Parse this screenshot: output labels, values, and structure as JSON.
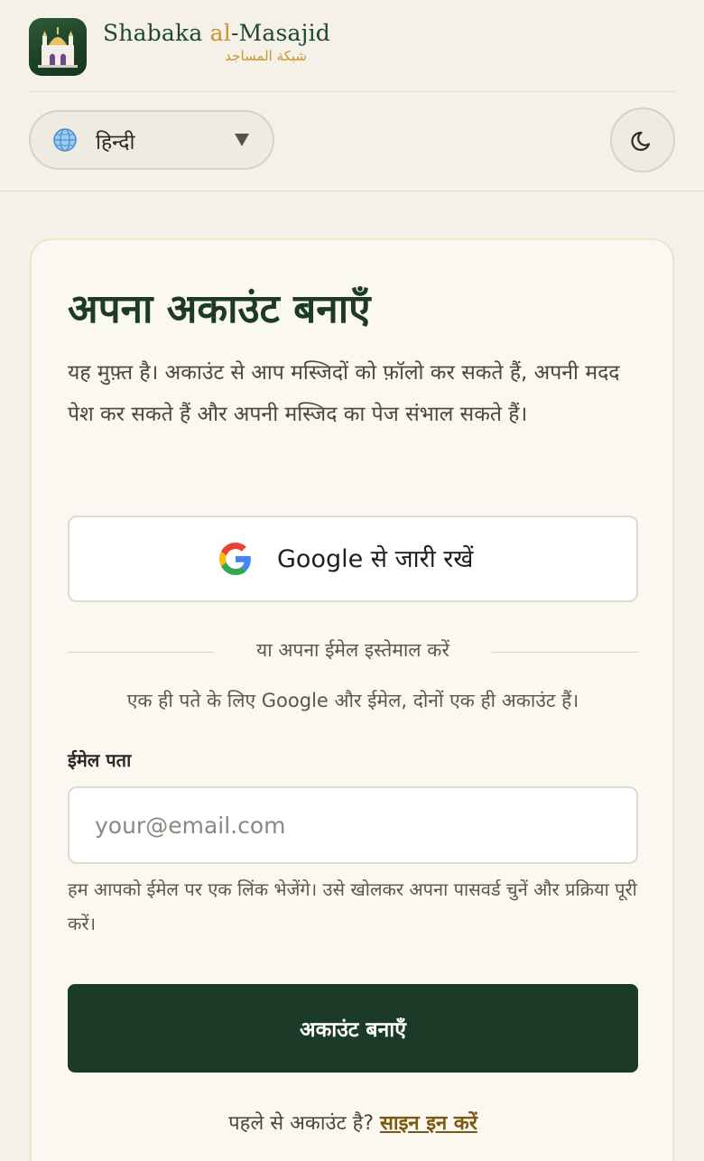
{
  "brand": {
    "name_part1": "Shabaka ",
    "name_part2": "al",
    "name_part3": "-Masajid",
    "name_arabic": "شبكة المساجد"
  },
  "language_selector": {
    "selected": "हिन्दी",
    "icon": "globe-icon"
  },
  "theme_toggle": {
    "icon": "moon-icon"
  },
  "signup": {
    "title": "अपना अकाउंट बनाएँ",
    "description": "यह मुफ़्त है। अकाउंट से आप मस्जिदों को फ़ॉलो कर सकते हैं, अपनी मदद पेश कर सकते हैं और अपनी मस्जिद का पेज संभाल सकते हैं।",
    "google_button": "Google से जारी रखें",
    "divider": "या अपना ईमेल इस्तेमाल करें",
    "note": "एक ही पते के लिए Google और ईमेल, दोनों एक ही अकाउंट हैं।",
    "email_label": "ईमेल पता",
    "email_placeholder": "your@email.com",
    "email_help": "हम आपको ईमेल पर एक लिंक भेजेंगे। उसे खोलकर अपना पासवर्ड चुनें और प्रक्रिया पूरी करें।",
    "submit_button": "अकाउंट बनाएँ",
    "existing_prompt": "पहले से अकाउंट है? ",
    "signin_link": "साइन इन करें"
  },
  "colors": {
    "background": "#f6f1e8",
    "primary": "#1b3a28",
    "accent_gold": "#c9952c",
    "link": "#7a5a10"
  }
}
